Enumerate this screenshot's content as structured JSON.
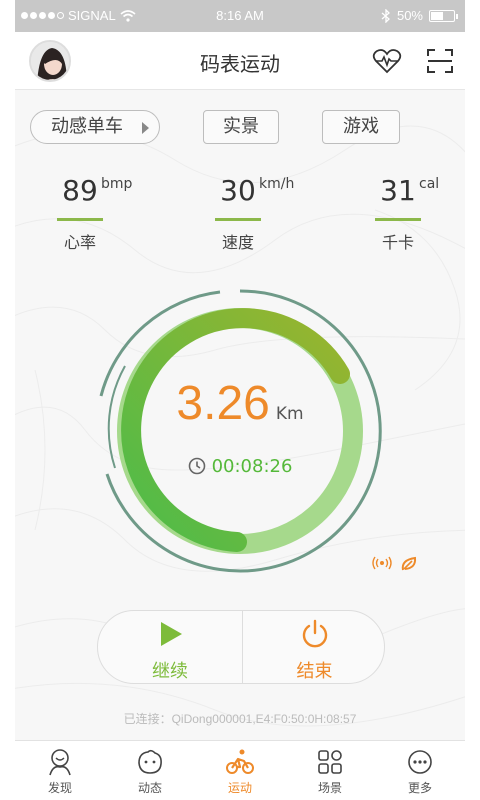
{
  "status_bar": {
    "carrier": "SIGNAL",
    "time": "8:16 AM",
    "battery": "50%",
    "battery_level": 0.5
  },
  "header": {
    "title": "码表运动",
    "heart_icon": "heart-pulse-icon",
    "scan_icon": "scan-icon"
  },
  "modes": {
    "bike": "动感单车",
    "real": "实景",
    "game": "游戏"
  },
  "stats": [
    {
      "value": "89",
      "unit": "bmp",
      "label": "心率"
    },
    {
      "value": "30",
      "unit": "km/h",
      "label": "速度"
    },
    {
      "value": "31",
      "unit": "cal",
      "label": "千卡"
    }
  ],
  "ride": {
    "distance": "3.26",
    "distance_unit": "Km",
    "duration": "00:08:26"
  },
  "controls": {
    "resume": "继续",
    "end": "结束"
  },
  "connection": "已连接：QiDong000001,E4:F0:50:0H:08:57",
  "tabs": [
    {
      "label": "发现",
      "icon": "discover-icon"
    },
    {
      "label": "动态",
      "icon": "feed-icon"
    },
    {
      "label": "运动",
      "icon": "cycling-icon",
      "active": true
    },
    {
      "label": "场景",
      "icon": "scenes-icon"
    },
    {
      "label": "更多",
      "icon": "more-icon"
    }
  ],
  "colors": {
    "accent_orange": "#ee8a2a",
    "green": "#55b93a",
    "ring_border": "#6f9a88"
  }
}
